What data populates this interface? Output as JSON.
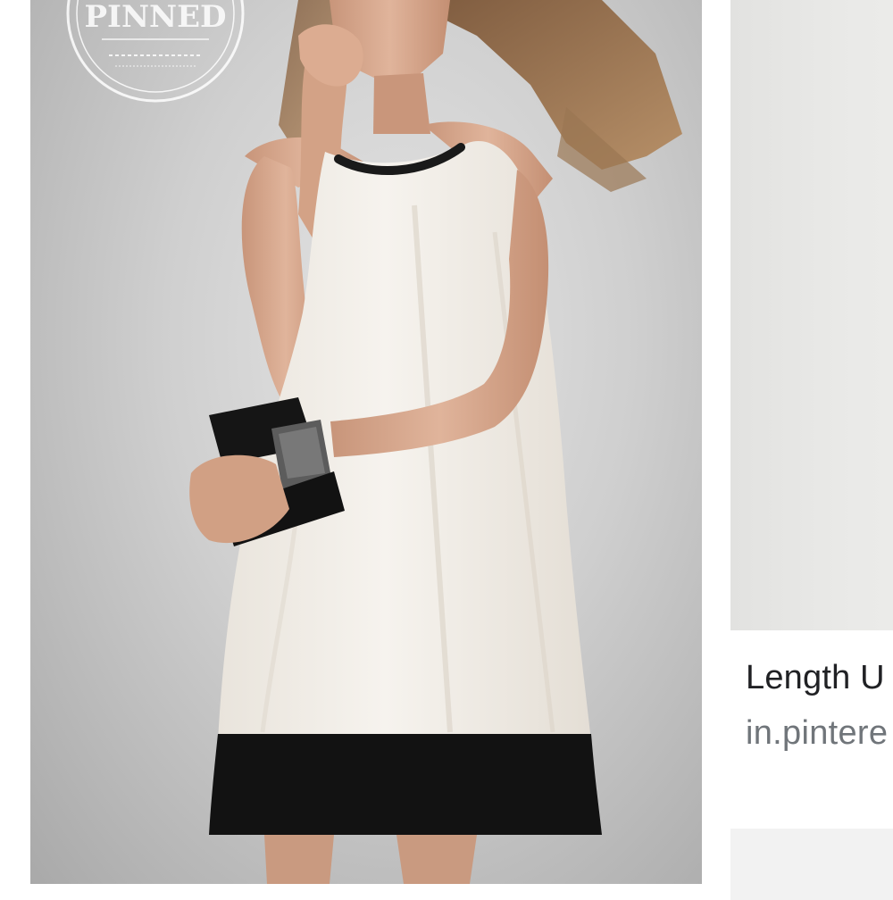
{
  "results": {
    "main": {
      "image_alt": "Woman in a sleeveless cream shift dress with a black hem band",
      "stamp": {
        "main_text": "PINNED"
      }
    },
    "next": {
      "title": "Length U",
      "source": "in.pintere"
    }
  },
  "colors": {
    "dress": "#f3efe8",
    "hem": "#121212",
    "skin": "#d6a78b",
    "hair": "#a07a57",
    "title_text": "#202124",
    "source_text": "#70757a"
  }
}
